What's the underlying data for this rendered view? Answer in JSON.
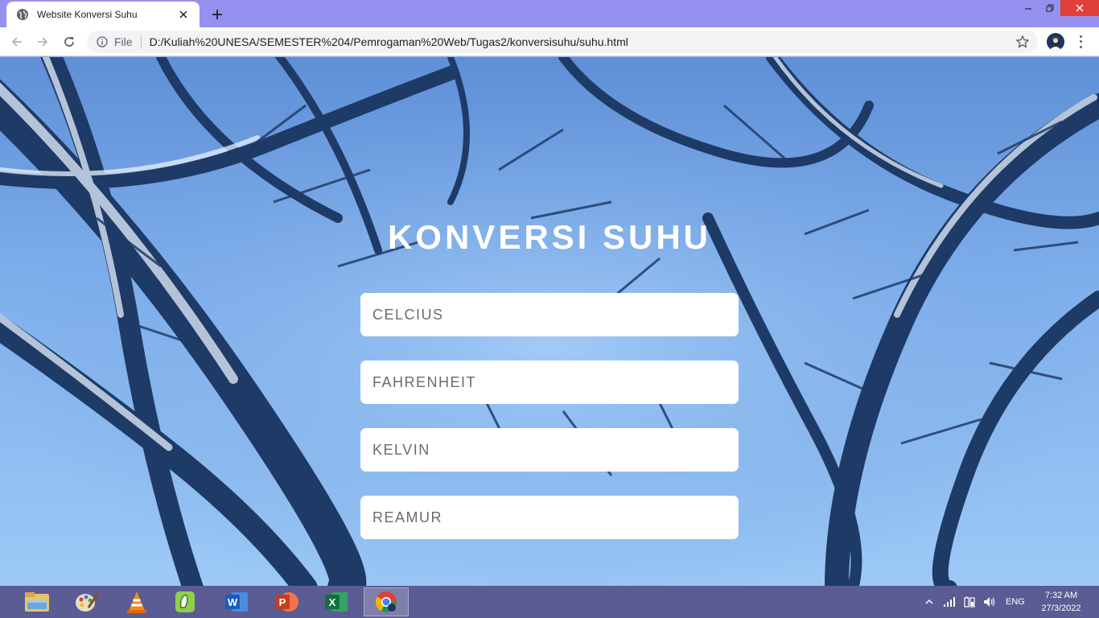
{
  "browser": {
    "tab_title": "Website Konversi Suhu",
    "scheme_label": "File",
    "url": "D:/Kuliah%20UNESA/SEMESTER%204/Pemrogaman%20Web/Tugas2/konversisuhu/suhu.html"
  },
  "page": {
    "heading": "KONVERSI SUHU",
    "fields": [
      {
        "placeholder": "CELCIUS"
      },
      {
        "placeholder": "FAHRENHEIT"
      },
      {
        "placeholder": "KELVIN"
      },
      {
        "placeholder": "REAMUR"
      }
    ]
  },
  "taskbar": {
    "apps": [
      {
        "icon": "file-explorer-icon"
      },
      {
        "icon": "paint-icon"
      },
      {
        "icon": "vlc-icon"
      },
      {
        "icon": "coreldraw-icon"
      },
      {
        "icon": "word-icon"
      },
      {
        "icon": "powerpoint-icon"
      },
      {
        "icon": "excel-icon"
      },
      {
        "icon": "chrome-icon"
      }
    ],
    "language": "ENG",
    "time": "7:32 AM",
    "date": "27/3/2022"
  },
  "colors": {
    "titlebar": "#9691f0",
    "taskbar": "#5b5c94",
    "close_button": "#e0403a",
    "sky": "#80b0ec"
  }
}
